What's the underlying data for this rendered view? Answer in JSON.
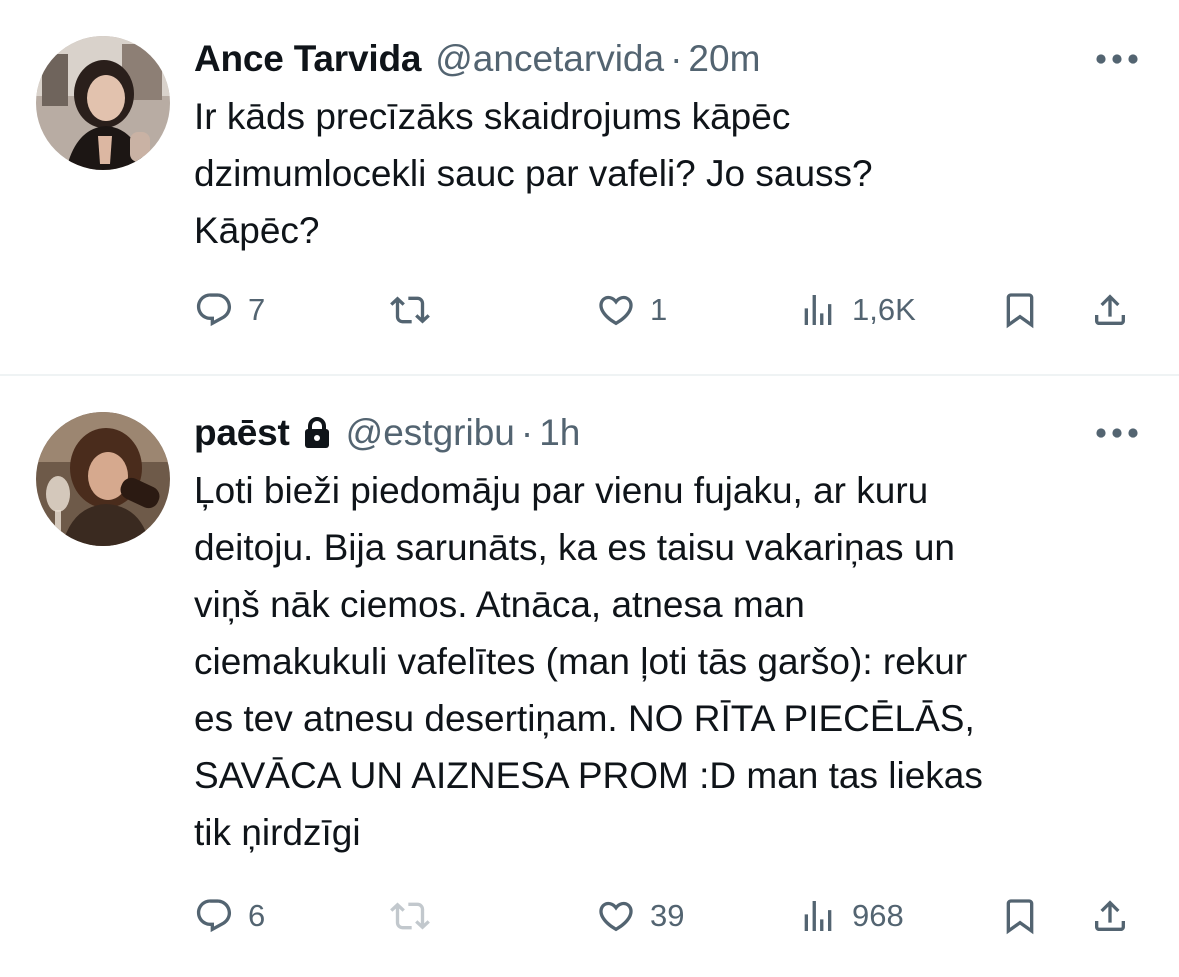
{
  "tweets": [
    {
      "display_name": "Ance Tarvida",
      "handle": "@ancetarvida",
      "separator": "·",
      "time": "20m",
      "locked": false,
      "text": "Ir kāds precīzāks skaidrojums kāpēc\ndzimumlocekli sauc par vafeli? Jo sauss?\nKāpēc?",
      "avatar_icon": "profile-photo",
      "actions": {
        "reply_count": "7",
        "retweet_count": "",
        "like_count": "1",
        "views_count": "1,6K"
      },
      "icons": {
        "reply": "reply-icon",
        "retweet": "retweet-icon",
        "like": "heart-icon",
        "views": "views-icon",
        "bookmark": "bookmark-icon",
        "share": "share-icon",
        "more": "more-icon"
      }
    },
    {
      "display_name": "paēst",
      "handle": "@estgribu",
      "separator": "·",
      "time": "1h",
      "locked": true,
      "text": "Ļoti bieži piedomāju par vienu fujaku, ar kuru\ndeitoju. Bija sarunāts, ka es taisu vakariņas un\nviņš nāk ciemos. Atnāca, atnesa man\nciemakukuli vafelītes (man ļoti tās garšo): rekur\nes tev atnesu desertiņam. NO RĪTA PIECĒLĀS,\nSAVĀCA UN AIZNESA PROM :D man tas liekas\ntik ņirdzīgi",
      "avatar_icon": "profile-photo",
      "actions": {
        "reply_count": "6",
        "retweet_count": "",
        "like_count": "39",
        "views_count": "968"
      },
      "icons": {
        "lock": "lock-icon",
        "reply": "reply-icon",
        "retweet": "retweet-icon",
        "like": "heart-icon",
        "views": "views-icon",
        "bookmark": "bookmark-icon",
        "share": "share-icon",
        "more": "more-icon"
      }
    }
  ],
  "colors": {
    "text_primary": "#0f1419",
    "text_secondary": "#536471",
    "divider": "#eff3f4"
  }
}
